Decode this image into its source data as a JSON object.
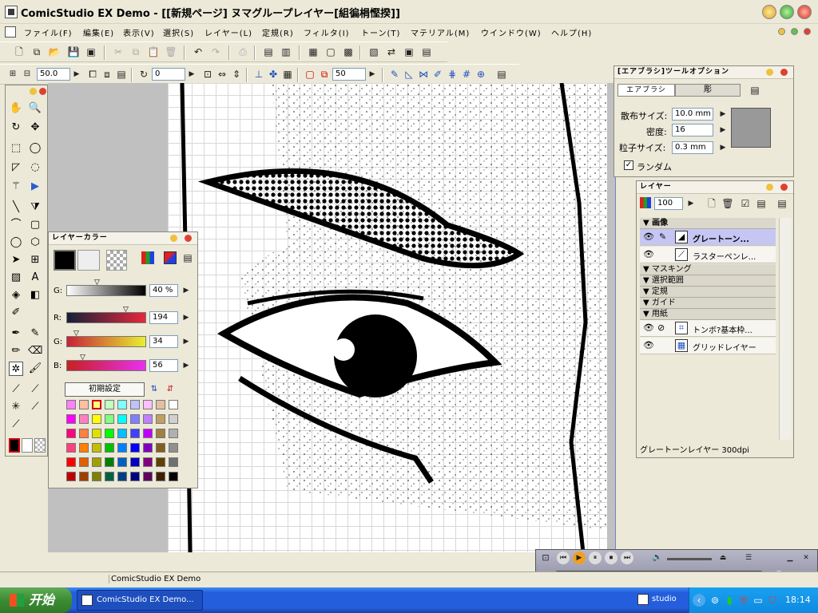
{
  "window": {
    "title": "ComicStudio EX Demo - [[新規ページ] ヌマグループレイヤー[組徧梋慳揆]]"
  },
  "menu": [
    "ファイル(F)",
    "編集(E)",
    "表示(V)",
    "選択(S)",
    "レイヤー(L)",
    "定規(R)",
    "フィルタ(I)",
    "トーン(T)",
    "マテリアル(M)",
    "ウインドウ(W)",
    "ヘルプ(H)"
  ],
  "toolbar2": {
    "zoom_value": "50.0",
    "rotate_value": "0",
    "size_value": "50"
  },
  "airbrush_panel": {
    "title": "[エアブラシ]ツールオプション",
    "tab1": "エアブラシ",
    "tab2": "彫",
    "spread_label": "散布サイズ:",
    "spread_value": "10.0 mm",
    "density_label": "密度:",
    "density_value": "16",
    "particle_label": "粒子サイズ:",
    "particle_value": "0.3 mm",
    "random_label": "ランダム",
    "random_checked": true,
    "preview_color": "#999999"
  },
  "layer_color_panel": {
    "title": "レイヤーカラー",
    "g_label": "G:",
    "g_value": "40 %",
    "r_label": "R:",
    "r_value": "194",
    "g2_label": "G:",
    "g2_value": "34",
    "b_label": "B:",
    "b_value": "56",
    "reset_label": "初期設定",
    "swatches": [
      [
        "#ff80ff",
        "#ffc0a0",
        "#ffff80",
        "#c0ffc0",
        "#80ffff",
        "#c0c0ff",
        "#ffc0ff",
        "#e0c0a0",
        "#ffffff"
      ],
      [
        "#ff00ff",
        "#ff80c0",
        "#ffff00",
        "#80ff80",
        "#00ffff",
        "#8080ff",
        "#c080ff",
        "#c0a060",
        "#d0d0d0"
      ],
      [
        "#ff0080",
        "#ff8040",
        "#e0e000",
        "#00ff00",
        "#00c0ff",
        "#4040ff",
        "#c000ff",
        "#a08040",
        "#b0b0b0"
      ],
      [
        "#ff4080",
        "#ff8000",
        "#c0c000",
        "#00c000",
        "#0080ff",
        "#0000ff",
        "#8000c0",
        "#806020",
        "#909090"
      ],
      [
        "#ff0000",
        "#e06000",
        "#a0a000",
        "#008000",
        "#0060c0",
        "#0000c0",
        "#800080",
        "#604000",
        "#707070"
      ],
      [
        "#c00000",
        "#a04000",
        "#808000",
        "#006040",
        "#004080",
        "#000080",
        "#600060",
        "#402000",
        "#000000"
      ]
    ]
  },
  "layer_panel": {
    "title": "レイヤー",
    "opacity": "100",
    "groups": {
      "image": "画像",
      "masking": "マスキング",
      "selection": "選択範囲",
      "ruler": "定規",
      "guide": "ガイド",
      "paper": "用紙"
    },
    "layers": [
      {
        "name": "グレートーン...",
        "selected": true
      },
      {
        "name": "ラスターペンレ..."
      },
      {
        "name": "トンボ?基本枠..."
      },
      {
        "name": "グリッドレイヤー"
      }
    ],
    "status": "グレートーンレイヤー 300dpi"
  },
  "statusbar": {
    "text": "ComicStudio EX Demo"
  },
  "taskbar": {
    "start": "开始",
    "task": "ComicStudio EX Demo...",
    "clock": "18:14",
    "tray_label": "studio"
  },
  "colors": {
    "selected_layer": "#c6c6f5",
    "accent": "#245edc",
    "player_bar": "#f0a020"
  }
}
